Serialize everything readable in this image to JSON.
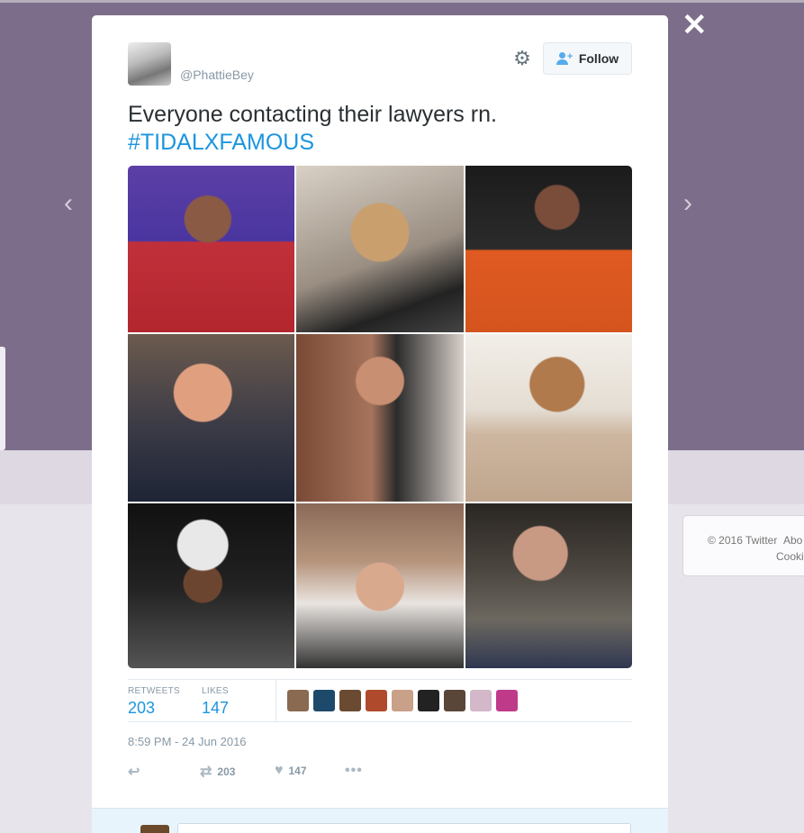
{
  "tweet": {
    "username": "@PhattieBey",
    "follow_label": "Follow",
    "text": "Everyone contacting their lawyers rn.",
    "hashtag": "#TIDALXFAMOUS",
    "timestamp": "8:59 PM - 24 Jun 2016"
  },
  "stats": {
    "retweets_label": "RETWEETS",
    "retweets_value": "203",
    "likes_label": "LIKES",
    "likes_value": "147"
  },
  "actions": {
    "retweet_count": "203",
    "like_count": "147"
  },
  "sidebar_card": {
    "copyright": "© 2016 Twitter",
    "about": "Abo",
    "cookies": "Cooki"
  },
  "likers": [
    "#8a6a50",
    "#1d4a6a",
    "#6b4a32",
    "#b04a2c",
    "#c9a088",
    "#222222",
    "#5a4638",
    "#d2b8c8",
    "#c03a8a"
  ],
  "icons": {
    "close": "close-icon",
    "prev": "chevron-left-icon",
    "next": "chevron-right-icon",
    "gear": "gear-icon",
    "follow": "follow-user-icon",
    "reply": "reply-icon",
    "retweet": "retweet-icon",
    "like": "heart-icon",
    "more": "more-icon"
  }
}
